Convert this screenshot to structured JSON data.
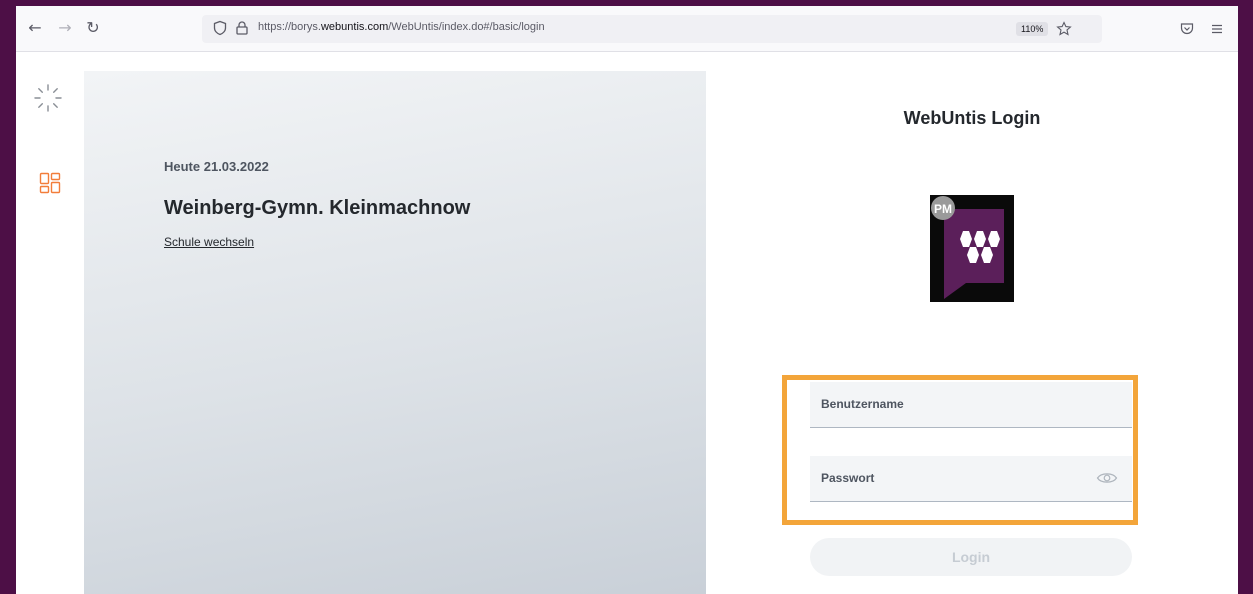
{
  "browser": {
    "url_prefix": "https://borys.",
    "url_domain": "webuntis.com",
    "url_path": "/WebUntis/index.do#/basic/login",
    "zoom": "110%"
  },
  "hero": {
    "date_text": "Heute 21.03.2022",
    "school_name": "Weinberg-Gymn. Kleinmachnow",
    "switch_school": "Schule wechseln"
  },
  "login": {
    "title": "WebUntis Login",
    "logo_badge": "PM",
    "username_placeholder": "Benutzername",
    "password_placeholder": "Passwort",
    "submit_label": "Login"
  },
  "colors": {
    "frame": "#4d0f46",
    "logo_purple": "#5b1f5a",
    "highlight": "#f3a53a",
    "accent_orange": "#f27d3a"
  },
  "icons": [
    "back-arrow-icon",
    "forward-arrow-icon",
    "reload-icon",
    "shield-icon",
    "lock-icon",
    "star-icon",
    "pocket-icon",
    "menu-icon",
    "loading-spinner-icon",
    "dashboard-icon",
    "eye-icon"
  ]
}
